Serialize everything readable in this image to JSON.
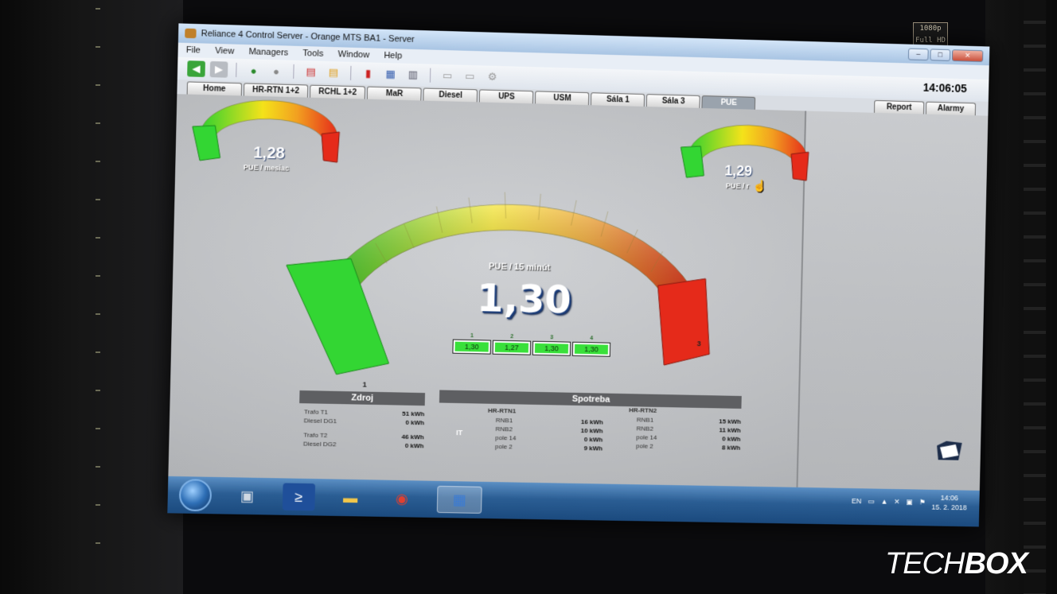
{
  "window": {
    "title": "Reliance 4 Control Server - Orange MTS BA1 - Server",
    "controls": {
      "minimize": "–",
      "maximize": "□",
      "close": "✕"
    }
  },
  "menu": [
    "File",
    "View",
    "Managers",
    "Tools",
    "Window",
    "Help"
  ],
  "toolbar": {
    "icons": [
      "back-icon",
      "forward-icon",
      "user-login-icon",
      "user-logout-icon",
      "alarm-doc-icon",
      "alarm-warning-icon",
      "chart-icon",
      "report-icon",
      "print-preview-icon",
      "print-icon",
      "print-setup-icon",
      "settings-icon"
    ],
    "clock": "14:06:05"
  },
  "tabs": [
    "Home",
    "HR-RTN 1+2",
    "RCHL 1+2",
    "MaR",
    "Diesel",
    "UPS",
    "USM",
    "Sála 1",
    "Sála 3",
    "PUE"
  ],
  "active_tab": "PUE",
  "right_tabs": [
    "Report",
    "Alarmy"
  ],
  "gauges": {
    "main": {
      "value": "1,30",
      "label": "PUE / 15 minút",
      "min_label": "1",
      "max_label": "3"
    },
    "month": {
      "value": "1,28",
      "label": "PUE / mesiac"
    },
    "year": {
      "value": "1,29",
      "label": "PUE / r"
    }
  },
  "sub_values": [
    {
      "index": "1",
      "value": "1,30"
    },
    {
      "index": "2",
      "value": "1,27"
    },
    {
      "index": "3",
      "value": "1,30"
    },
    {
      "index": "4",
      "value": "1,30"
    }
  ],
  "zdroj": {
    "title": "Zdroj",
    "rows": [
      {
        "label": "Trafo T1",
        "value": "51 kWh"
      },
      {
        "label": "Diesel DG1",
        "value": "0 kWh"
      },
      {
        "label": "Trafo T2",
        "value": "46 kWh"
      },
      {
        "label": "Diesel DG2",
        "value": "0 kWh"
      }
    ]
  },
  "spotreba": {
    "title": "Spotreba",
    "it_label": "IT",
    "groups": [
      {
        "name": "HR-RTN1",
        "rows": [
          {
            "label": "RNB1",
            "value": "16 kWh"
          },
          {
            "label": "RNB2",
            "value": "10 kWh"
          },
          {
            "label": "pole 14",
            "value": "0 kWh"
          },
          {
            "label": "pole 2",
            "value": "9 kWh"
          }
        ]
      },
      {
        "name": "HR-RTN2",
        "rows": [
          {
            "label": "RNB1",
            "value": "15 kWh"
          },
          {
            "label": "RNB2",
            "value": "11 kWh"
          },
          {
            "label": "pole 14",
            "value": "0 kWh"
          },
          {
            "label": "pole 2",
            "value": "8 kWh"
          }
        ]
      }
    ]
  },
  "taskbar": {
    "apps": [
      "start-button",
      "server-manager",
      "powershell",
      "file-explorer",
      "chrome",
      "reliance-4"
    ],
    "language": "EN",
    "time": "14:06",
    "date": "15. 2. 2018"
  },
  "overlay": {
    "badge_line1": "1080p",
    "badge_line2": "Full HD",
    "watermark_a": "TECH",
    "watermark_b": "BOX"
  },
  "colors": {
    "gauge_low": "#2fd12f",
    "gauge_mid": "#f4e21a",
    "gauge_high": "#e52a1a",
    "tab_active": "#9aa3ad"
  }
}
